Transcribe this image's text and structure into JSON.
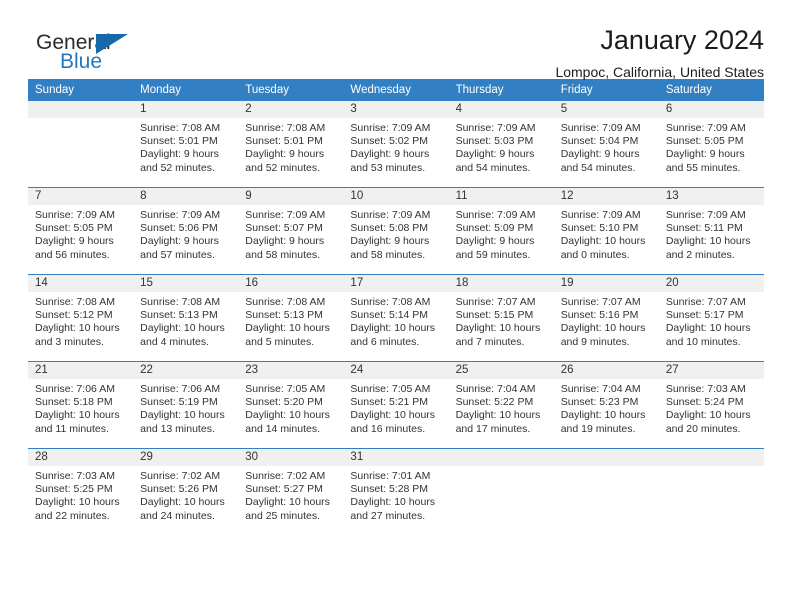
{
  "brand": {
    "name_part1": "General",
    "name_part2": "Blue",
    "accent_color": "#2379c1",
    "triangle_color": "#1767ab"
  },
  "header": {
    "title": "January 2024",
    "subtitle": "Lompoc, California, United States"
  },
  "calendar": {
    "header_bg": "#3280c3",
    "daynum_bg": "#f0f0f0",
    "weekdays": [
      "Sunday",
      "Monday",
      "Tuesday",
      "Wednesday",
      "Thursday",
      "Friday",
      "Saturday"
    ],
    "weeks": [
      [
        {
          "day": "",
          "lines": []
        },
        {
          "day": "1",
          "lines": [
            "Sunrise: 7:08 AM",
            "Sunset: 5:01 PM",
            "Daylight: 9 hours",
            "and 52 minutes."
          ]
        },
        {
          "day": "2",
          "lines": [
            "Sunrise: 7:08 AM",
            "Sunset: 5:01 PM",
            "Daylight: 9 hours",
            "and 52 minutes."
          ]
        },
        {
          "day": "3",
          "lines": [
            "Sunrise: 7:09 AM",
            "Sunset: 5:02 PM",
            "Daylight: 9 hours",
            "and 53 minutes."
          ]
        },
        {
          "day": "4",
          "lines": [
            "Sunrise: 7:09 AM",
            "Sunset: 5:03 PM",
            "Daylight: 9 hours",
            "and 54 minutes."
          ]
        },
        {
          "day": "5",
          "lines": [
            "Sunrise: 7:09 AM",
            "Sunset: 5:04 PM",
            "Daylight: 9 hours",
            "and 54 minutes."
          ]
        },
        {
          "day": "6",
          "lines": [
            "Sunrise: 7:09 AM",
            "Sunset: 5:05 PM",
            "Daylight: 9 hours",
            "and 55 minutes."
          ]
        }
      ],
      [
        {
          "day": "7",
          "lines": [
            "Sunrise: 7:09 AM",
            "Sunset: 5:05 PM",
            "Daylight: 9 hours",
            "and 56 minutes."
          ]
        },
        {
          "day": "8",
          "lines": [
            "Sunrise: 7:09 AM",
            "Sunset: 5:06 PM",
            "Daylight: 9 hours",
            "and 57 minutes."
          ]
        },
        {
          "day": "9",
          "lines": [
            "Sunrise: 7:09 AM",
            "Sunset: 5:07 PM",
            "Daylight: 9 hours",
            "and 58 minutes."
          ]
        },
        {
          "day": "10",
          "lines": [
            "Sunrise: 7:09 AM",
            "Sunset: 5:08 PM",
            "Daylight: 9 hours",
            "and 58 minutes."
          ]
        },
        {
          "day": "11",
          "lines": [
            "Sunrise: 7:09 AM",
            "Sunset: 5:09 PM",
            "Daylight: 9 hours",
            "and 59 minutes."
          ]
        },
        {
          "day": "12",
          "lines": [
            "Sunrise: 7:09 AM",
            "Sunset: 5:10 PM",
            "Daylight: 10 hours",
            "and 0 minutes."
          ]
        },
        {
          "day": "13",
          "lines": [
            "Sunrise: 7:09 AM",
            "Sunset: 5:11 PM",
            "Daylight: 10 hours",
            "and 2 minutes."
          ]
        }
      ],
      [
        {
          "day": "14",
          "lines": [
            "Sunrise: 7:08 AM",
            "Sunset: 5:12 PM",
            "Daylight: 10 hours",
            "and 3 minutes."
          ]
        },
        {
          "day": "15",
          "lines": [
            "Sunrise: 7:08 AM",
            "Sunset: 5:13 PM",
            "Daylight: 10 hours",
            "and 4 minutes."
          ]
        },
        {
          "day": "16",
          "lines": [
            "Sunrise: 7:08 AM",
            "Sunset: 5:13 PM",
            "Daylight: 10 hours",
            "and 5 minutes."
          ]
        },
        {
          "day": "17",
          "lines": [
            "Sunrise: 7:08 AM",
            "Sunset: 5:14 PM",
            "Daylight: 10 hours",
            "and 6 minutes."
          ]
        },
        {
          "day": "18",
          "lines": [
            "Sunrise: 7:07 AM",
            "Sunset: 5:15 PM",
            "Daylight: 10 hours",
            "and 7 minutes."
          ]
        },
        {
          "day": "19",
          "lines": [
            "Sunrise: 7:07 AM",
            "Sunset: 5:16 PM",
            "Daylight: 10 hours",
            "and 9 minutes."
          ]
        },
        {
          "day": "20",
          "lines": [
            "Sunrise: 7:07 AM",
            "Sunset: 5:17 PM",
            "Daylight: 10 hours",
            "and 10 minutes."
          ]
        }
      ],
      [
        {
          "day": "21",
          "lines": [
            "Sunrise: 7:06 AM",
            "Sunset: 5:18 PM",
            "Daylight: 10 hours",
            "and 11 minutes."
          ]
        },
        {
          "day": "22",
          "lines": [
            "Sunrise: 7:06 AM",
            "Sunset: 5:19 PM",
            "Daylight: 10 hours",
            "and 13 minutes."
          ]
        },
        {
          "day": "23",
          "lines": [
            "Sunrise: 7:05 AM",
            "Sunset: 5:20 PM",
            "Daylight: 10 hours",
            "and 14 minutes."
          ]
        },
        {
          "day": "24",
          "lines": [
            "Sunrise: 7:05 AM",
            "Sunset: 5:21 PM",
            "Daylight: 10 hours",
            "and 16 minutes."
          ]
        },
        {
          "day": "25",
          "lines": [
            "Sunrise: 7:04 AM",
            "Sunset: 5:22 PM",
            "Daylight: 10 hours",
            "and 17 minutes."
          ]
        },
        {
          "day": "26",
          "lines": [
            "Sunrise: 7:04 AM",
            "Sunset: 5:23 PM",
            "Daylight: 10 hours",
            "and 19 minutes."
          ]
        },
        {
          "day": "27",
          "lines": [
            "Sunrise: 7:03 AM",
            "Sunset: 5:24 PM",
            "Daylight: 10 hours",
            "and 20 minutes."
          ]
        }
      ],
      [
        {
          "day": "28",
          "lines": [
            "Sunrise: 7:03 AM",
            "Sunset: 5:25 PM",
            "Daylight: 10 hours",
            "and 22 minutes."
          ]
        },
        {
          "day": "29",
          "lines": [
            "Sunrise: 7:02 AM",
            "Sunset: 5:26 PM",
            "Daylight: 10 hours",
            "and 24 minutes."
          ]
        },
        {
          "day": "30",
          "lines": [
            "Sunrise: 7:02 AM",
            "Sunset: 5:27 PM",
            "Daylight: 10 hours",
            "and 25 minutes."
          ]
        },
        {
          "day": "31",
          "lines": [
            "Sunrise: 7:01 AM",
            "Sunset: 5:28 PM",
            "Daylight: 10 hours",
            "and 27 minutes."
          ]
        },
        {
          "day": "",
          "lines": []
        },
        {
          "day": "",
          "lines": []
        },
        {
          "day": "",
          "lines": []
        }
      ]
    ]
  }
}
